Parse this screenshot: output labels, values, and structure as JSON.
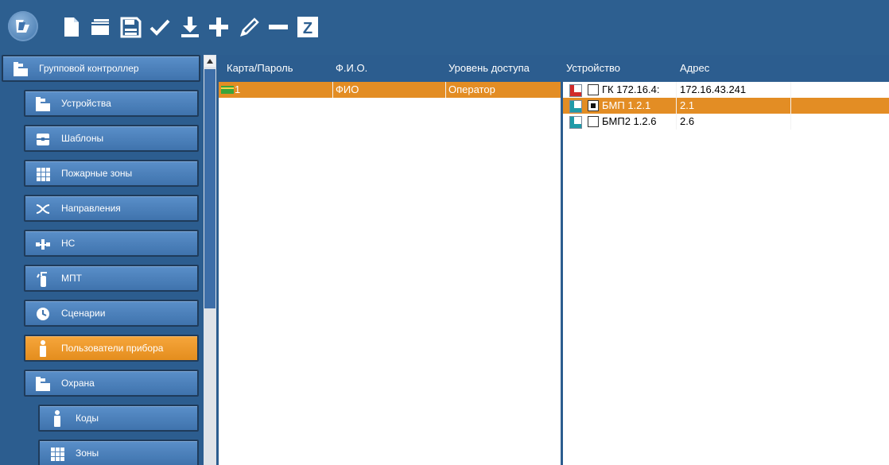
{
  "toolbar": {
    "logo_icon": "app-logo-icon",
    "buttons": [
      {
        "name": "new-document-button",
        "icon": "document-icon"
      },
      {
        "name": "open-button",
        "icon": "folder-icon"
      },
      {
        "name": "save-button",
        "icon": "floppy-disk-icon"
      },
      {
        "name": "apply-button",
        "icon": "checkmark-icon"
      },
      {
        "name": "download-button",
        "icon": "download-icon"
      },
      {
        "name": "add-button",
        "icon": "plus-icon"
      },
      {
        "name": "edit-button",
        "icon": "pencil-icon"
      },
      {
        "name": "remove-button",
        "icon": "minus-icon"
      },
      {
        "name": "z-button",
        "icon": "z-letter-icon",
        "label": "Z"
      }
    ]
  },
  "nav": {
    "items": [
      {
        "label": "Групповой контроллер",
        "icon": "tree-icon",
        "active": false
      },
      {
        "label": "Устройства",
        "icon": "tree-icon",
        "active": false
      },
      {
        "label": "Шаблоны",
        "icon": "template-icon",
        "active": false
      },
      {
        "label": "Пожарные зоны",
        "icon": "grid-icon",
        "active": false
      },
      {
        "label": "Направления",
        "icon": "shuffle-icon",
        "active": false
      },
      {
        "label": "НС",
        "icon": "pump-icon",
        "active": false
      },
      {
        "label": "МПТ",
        "icon": "extinguisher-icon",
        "active": false
      },
      {
        "label": "Сценарии",
        "icon": "clock-icon",
        "active": false
      },
      {
        "label": "Пользователи прибора",
        "icon": "user-icon",
        "active": true
      },
      {
        "label": "Охрана",
        "icon": "tree-icon",
        "active": false
      },
      {
        "label": "Коды",
        "icon": "user-icon",
        "active": false
      },
      {
        "label": "Зоны",
        "icon": "grid-icon",
        "active": false
      }
    ]
  },
  "users_table": {
    "columns": [
      "Карта/Пароль",
      "Ф.И.О.",
      "Уровень доступа"
    ],
    "rows": [
      {
        "card": "1",
        "name": "ФИО",
        "access": "Оператор",
        "selected": true
      }
    ]
  },
  "devices_table": {
    "columns": [
      "Устройство",
      "Адрес"
    ],
    "rows": [
      {
        "device": "ГК 172.16.4:",
        "address": "172.16.43.241",
        "checked": false,
        "selected": false,
        "indicator": "red"
      },
      {
        "device": "БМП 1.2.1",
        "address": "2.1",
        "checked": true,
        "selected": true,
        "indicator": "teal"
      },
      {
        "device": "БМП2 1.2.6",
        "address": "2.6",
        "checked": false,
        "selected": false,
        "indicator": "teal"
      }
    ]
  },
  "colors": {
    "background": "#2c5d8f",
    "nav_item": "#4a7fbb",
    "active": "#f0a030",
    "selection": "#e38d24"
  }
}
